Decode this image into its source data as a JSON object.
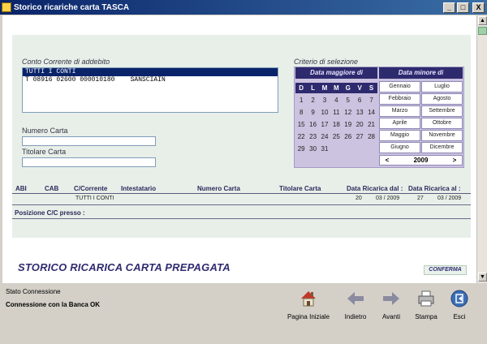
{
  "window": {
    "title": "Storico ricariche carta TASCA",
    "min": "_",
    "max": "□",
    "close": "X"
  },
  "conto": {
    "label": "Conto Corrente di addebito",
    "items": [
      "TUTTI I CONTI",
      "T 08916 02600 000010180    SANSCIAIN"
    ]
  },
  "numero_carta": {
    "label": "Numero Carta",
    "value": ""
  },
  "titolare_carta": {
    "label": "Titolare Carta",
    "value": ""
  },
  "criterio": {
    "label": "Criterio di selezione",
    "data_maggiore": "Data maggiore di",
    "data_minore": "Data minore di",
    "weekdays": [
      "D",
      "L",
      "M",
      "M",
      "G",
      "V",
      "S"
    ],
    "days": [
      [
        "1",
        "2",
        "3",
        "4",
        "5",
        "6",
        "7"
      ],
      [
        "8",
        "9",
        "10",
        "11",
        "12",
        "13",
        "14"
      ],
      [
        "15",
        "16",
        "17",
        "18",
        "19",
        "20",
        "21"
      ],
      [
        "22",
        "23",
        "24",
        "25",
        "26",
        "27",
        "28"
      ],
      [
        "29",
        "30",
        "31",
        "",
        "",
        "",
        ""
      ]
    ],
    "months": [
      [
        "Gennaio",
        "Luglio"
      ],
      [
        "Febbraio",
        "Agosto"
      ],
      [
        "Marzo",
        "Settembre"
      ],
      [
        "Aprile",
        "Ottobre"
      ],
      [
        "Maggio",
        "Novembre"
      ],
      [
        "Giugno",
        "Dicembre"
      ]
    ],
    "year": "2009",
    "prev": "<",
    "next": ">"
  },
  "table": {
    "headers": {
      "abi": "ABI",
      "cab": "CAB",
      "corrente": "C/Corrente",
      "intestatario": "Intestatario",
      "numero": "Numero Carta",
      "titolare": "Titolare Carta",
      "dal": "Data Ricarica dal :",
      "al": "Data Ricarica al :"
    },
    "row": {
      "corrente": "TUTTI I CONTI",
      "dal_d": "20",
      "dal_my": "03 / 2009",
      "al_d": "27",
      "al_my": "03 / 2009"
    },
    "posizione": "Posizione C/C presso :"
  },
  "footer_title": "STORICO RICARICA CARTA PREPAGATA",
  "conferma": "CONFERMA",
  "status": {
    "label": "Stato Connessione",
    "value": "Connessione con la Banca OK"
  },
  "toolbar": {
    "home": "Pagina Iniziale",
    "back": "Indietro",
    "forward": "Avanti",
    "print": "Stampa",
    "exit": "Esci"
  }
}
